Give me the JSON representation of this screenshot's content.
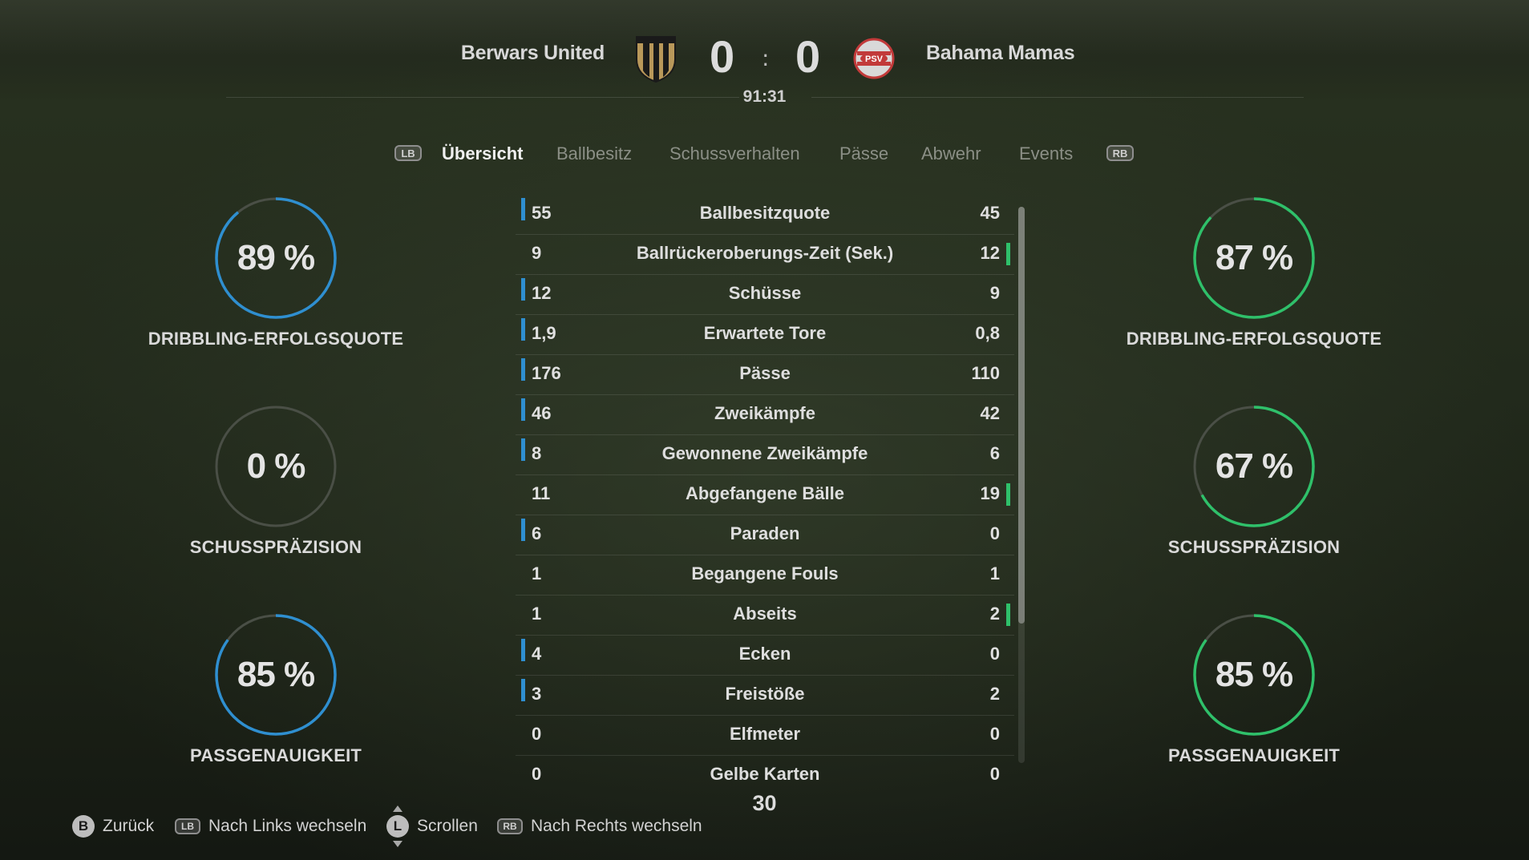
{
  "header": {
    "home_team": "Berwars United",
    "away_team": "Bahama Mamas",
    "home_score": "0",
    "away_score": "0",
    "separator": ":",
    "clock": "91:31",
    "home_crest_icon": "black-gold-shield-crest",
    "away_crest_icon": "psv-crest",
    "away_crest_text": "PSV"
  },
  "tabs": {
    "lb": "LB",
    "rb": "RB",
    "items": [
      "Übersicht",
      "Ballbesitz",
      "Schussverhalten",
      "Pässe",
      "Abwehr",
      "Events"
    ],
    "active": "Übersicht"
  },
  "home_gauges": [
    {
      "value": "89 %",
      "label": "DRIBBLING-ERFOLGSQUOTE",
      "percent": 89
    },
    {
      "value": "0 %",
      "label": "SCHUSSPRÄZISION",
      "percent": 0
    },
    {
      "value": "85 %",
      "label": "PASSGENAUIGKEIT",
      "percent": 85
    }
  ],
  "away_gauges": [
    {
      "value": "87 %",
      "label": "DRIBBLING-ERFOLGSQUOTE",
      "percent": 87
    },
    {
      "value": "67 %",
      "label": "SCHUSSPRÄZISION",
      "percent": 67
    },
    {
      "value": "85 %",
      "label": "PASSGENAUIGKEIT",
      "percent": 85
    }
  ],
  "colors": {
    "home_accent": "#2f8fd0",
    "away_accent": "#2fc06a",
    "gauge_track": "#4a4f46"
  },
  "stats": [
    {
      "home": "55",
      "label": "Ballbesitzquote",
      "away": "45",
      "leader": "home"
    },
    {
      "home": "9",
      "label": "Ballrückeroberungs-Zeit (Sek.)",
      "away": "12",
      "leader": "away"
    },
    {
      "home": "12",
      "label": "Schüsse",
      "away": "9",
      "leader": "home"
    },
    {
      "home": "1,9",
      "label": "Erwartete Tore",
      "away": "0,8",
      "leader": "home"
    },
    {
      "home": "176",
      "label": "Pässe",
      "away": "110",
      "leader": "home"
    },
    {
      "home": "46",
      "label": "Zweikämpfe",
      "away": "42",
      "leader": "home"
    },
    {
      "home": "8",
      "label": "Gewonnene Zweikämpfe",
      "away": "6",
      "leader": "home"
    },
    {
      "home": "11",
      "label": "Abgefangene Bälle",
      "away": "19",
      "leader": "away"
    },
    {
      "home": "6",
      "label": "Paraden",
      "away": "0",
      "leader": "home"
    },
    {
      "home": "1",
      "label": "Begangene Fouls",
      "away": "1",
      "leader": "none"
    },
    {
      "home": "1",
      "label": "Abseits",
      "away": "2",
      "leader": "away"
    },
    {
      "home": "4",
      "label": "Ecken",
      "away": "0",
      "leader": "home"
    },
    {
      "home": "3",
      "label": "Freistöße",
      "away": "2",
      "leader": "home"
    },
    {
      "home": "0",
      "label": "Elfmeter",
      "away": "0",
      "leader": "none"
    },
    {
      "home": "0",
      "label": "Gelbe Karten",
      "away": "0",
      "leader": "none"
    }
  ],
  "page_count": "30",
  "footer": {
    "back_button": "B",
    "back_label": "Zurück",
    "left_button": "LB",
    "left_label": "Nach Links wechseln",
    "scroll_button": "L",
    "scroll_label": "Scrollen",
    "right_button": "RB",
    "right_label": "Nach Rechts wechseln"
  }
}
